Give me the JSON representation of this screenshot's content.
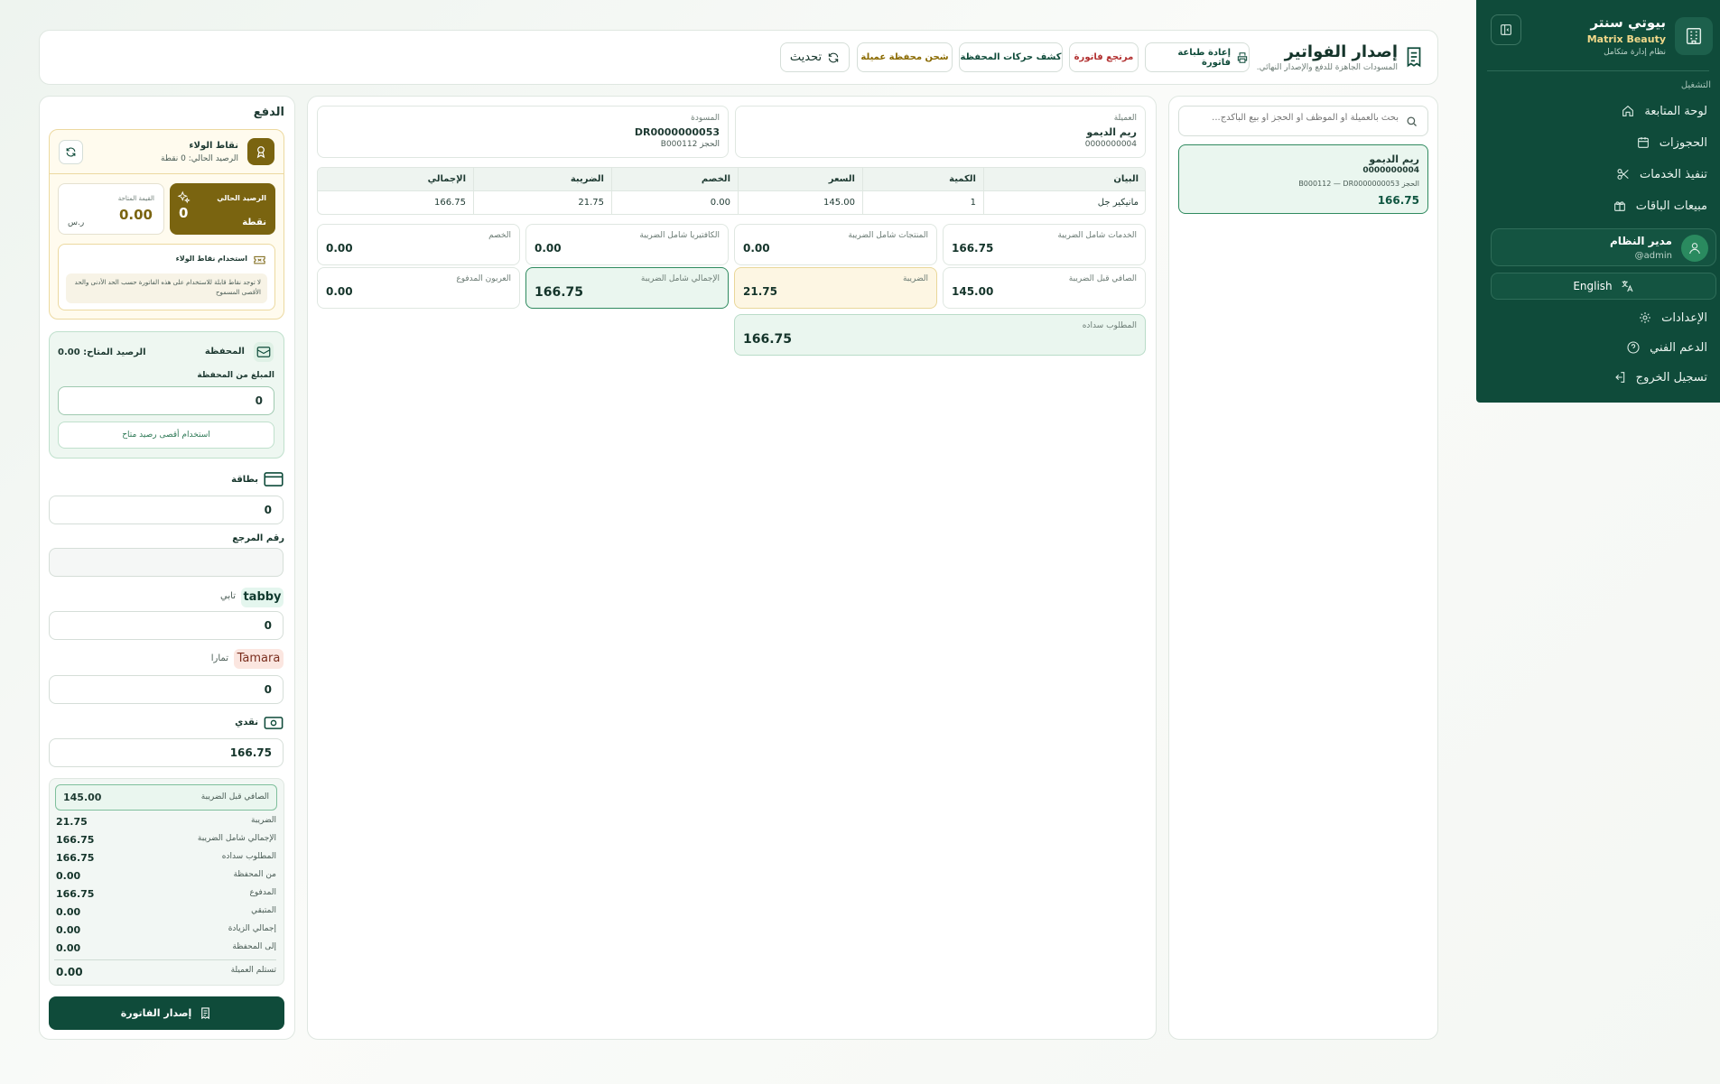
{
  "sidebar": {
    "brand_title": "بيوتي سنتر",
    "brand_subtitle": "Matrix Beauty",
    "brand_tagline": "نظام إدارة متكامل",
    "section_label": "التشغيل",
    "items": [
      {
        "label": "لوحة المتابعة",
        "icon": "home-icon"
      },
      {
        "label": "الحجوزات",
        "icon": "calendar-icon"
      },
      {
        "label": "تنفيذ الخدمات",
        "icon": "scissors-icon"
      },
      {
        "label": "مبيعات الباقات",
        "icon": "gift-icon"
      }
    ],
    "user": {
      "name": "مدير النظام",
      "handle": "@admin"
    },
    "language_button": "English",
    "settings": "الإعدادات",
    "support": "الدعم الفني",
    "logout": "تسجيل الخروج"
  },
  "header": {
    "title": "إصدار الفواتير",
    "subtitle": "المسودات الجاهزة للدفع والإصدار النهائي.",
    "buttons": {
      "reprint": "إعادة طباعة فاتورة",
      "refund": "مرتجع فاتورة",
      "wallet_statement": "كشف حركات المحفظة",
      "wallet_topup": "شحن محفظة عميلة",
      "refresh": "تحديث"
    }
  },
  "drafts": {
    "search_placeholder": "بحث بالعميلة أو الموظف أو الحجز أو بيع الباكدج...",
    "list": [
      {
        "client": "ريم الديمو",
        "phone": "0000000004",
        "ref": "الحجز B000112 — DR0000000053",
        "amount": "166.75"
      }
    ]
  },
  "detail": {
    "client_label": "العميلة",
    "client_name": "ريم الديمو",
    "client_phone": "0000000004",
    "draft_label": "المسودة",
    "draft_no": "DR0000000053",
    "booking_ref": "الحجز B000112",
    "table": {
      "headers": [
        "البيان",
        "الكمية",
        "السعر",
        "الخصم",
        "الضريبة",
        "الإجمالي"
      ],
      "rows": [
        [
          "مانيكير جل",
          "1",
          "145.00",
          "0.00",
          "21.75",
          "166.75"
        ]
      ]
    },
    "totals": {
      "services": {
        "label": "الخدمات شامل الضريبة",
        "value": "166.75"
      },
      "products": {
        "label": "المنتجات شامل الضريبة",
        "value": "0.00"
      },
      "cafeteria": {
        "label": "الكافتيريا شامل الضريبة",
        "value": "0.00"
      },
      "discount": {
        "label": "الخصم",
        "value": "0.00"
      },
      "net_before_tax": {
        "label": "الصافي قبل الضريبة",
        "value": "145.00"
      },
      "tax": {
        "label": "الضريبة",
        "value": "21.75"
      },
      "total_incl_tax": {
        "label": "الإجمالي شامل الضريبة",
        "value": "166.75"
      },
      "deposit_paid": {
        "label": "العربون المدفوع",
        "value": "0.00"
      },
      "amount_due": {
        "label": "المطلوب سداده",
        "value": "166.75"
      }
    }
  },
  "payment": {
    "title": "الدفع",
    "loyalty": {
      "title": "نقاط الولاء",
      "current_balance_text": "الرصيد الحالي: 0 نقطة",
      "balance_label": "الرصيد الحالي",
      "balance_value": "0",
      "balance_unit": "نقطة",
      "available_value_label": "القيمة المتاحة",
      "available_value": "0.00",
      "currency": "ر.س",
      "use_title": "استخدام نقاط الولاء",
      "notice": "لا توجد نقاط قابلة للاستخدام على هذه الفاتورة حسب الحد الأدنى والحد الأقصى المسموح"
    },
    "wallet": {
      "title": "المحفظة",
      "available_label": "الرصيد المتاح: 0.00",
      "amount_label": "المبلغ من المحفظة",
      "amount_value": "0",
      "use_max_button": "استخدام أقصى رصيد متاح"
    },
    "card": {
      "label": "بطاقة",
      "value": "0",
      "ref_label": "رقم المرجع",
      "ref_value": ""
    },
    "tabby": {
      "brand": "tabby",
      "label": "تابي",
      "value": "0"
    },
    "tamara": {
      "brand": "Tamara",
      "label": "تمارا",
      "value": "0"
    },
    "cash": {
      "label": "نقدي",
      "value": "166.75"
    },
    "summary": {
      "net_before_tax": {
        "label": "الصافي قبل الضريبة",
        "value": "145.00"
      },
      "rows": [
        {
          "label": "الضريبة",
          "value": "21.75"
        },
        {
          "label": "الإجمالي شامل الضريبة",
          "value": "166.75"
        },
        {
          "label": "المطلوب سداده",
          "value": "166.75"
        },
        {
          "label": "من المحفظة",
          "value": "0.00"
        },
        {
          "label": "المدفوع",
          "value": "166.75"
        },
        {
          "label": "المتبقي",
          "value": "0.00"
        },
        {
          "label": "إجمالي الزيادة",
          "value": "0.00"
        },
        {
          "label": "إلى المحفظة",
          "value": "0.00"
        }
      ],
      "client_receives": {
        "label": "تستلم العميلة",
        "value": "0.00"
      }
    },
    "issue_button": "إصدار الفاتورة"
  },
  "colors": {
    "primary": "#0f4b3a",
    "accent_gold": "#7a6410",
    "tax_bg": "#fdf6e3",
    "total_bg": "#eaf6ef"
  }
}
